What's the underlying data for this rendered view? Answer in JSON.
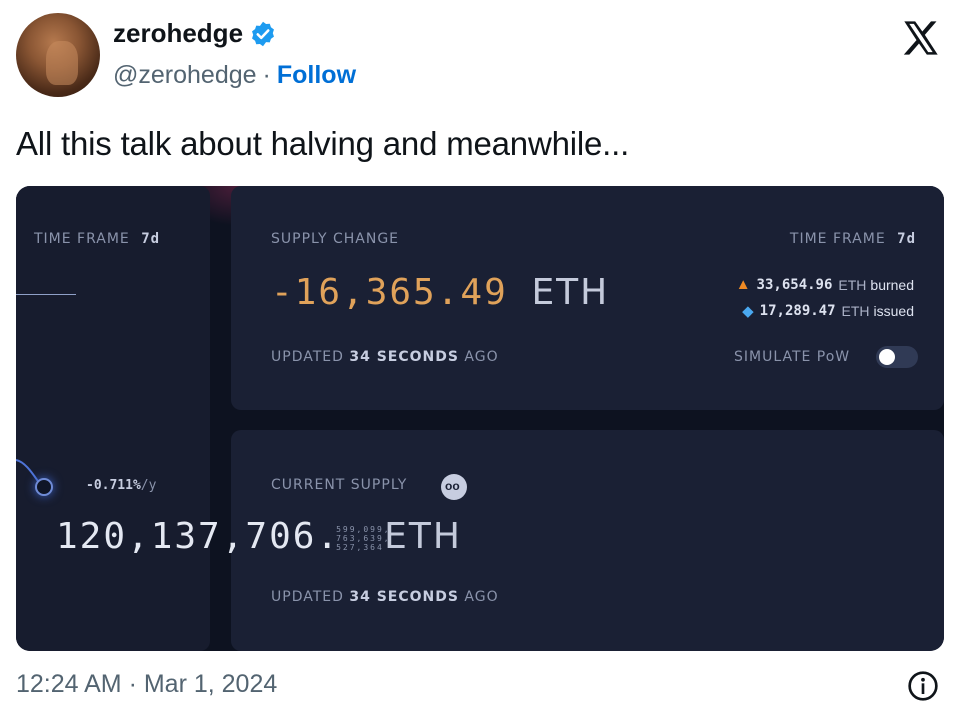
{
  "header": {
    "display_name": "zerohedge",
    "handle": "@zerohedge",
    "separator": "·",
    "follow_label": "Follow"
  },
  "tweet": {
    "text": "All this talk about halving and meanwhile...",
    "timestamp": "12:24 AM · Mar 1, 2024"
  },
  "dashboard": {
    "left": {
      "time_frame_label": "TIME FRAME",
      "time_frame_value": "7d",
      "rate_value": "-0.711%",
      "rate_unit": "/y"
    },
    "supply_change": {
      "label": "SUPPLY CHANGE",
      "value": "-16,365.49",
      "unit": "ETH",
      "updated_prefix": "UPDATED",
      "updated_value": "34 SECONDS",
      "updated_suffix": "AGO",
      "time_frame_label": "TIME FRAME",
      "time_frame_value": "7d",
      "burned_value": "33,654.96",
      "burned_unit": "ETH",
      "burned_label": "burned",
      "issued_value": "17,289.47",
      "issued_unit": "ETH",
      "issued_label": "issued",
      "simulate_label": "SIMULATE PoW"
    },
    "current_supply": {
      "label": "CURRENT SUPPLY",
      "value": "120,137,706.",
      "decimals_line1": "599,099,",
      "decimals_line2": "763,639,",
      "decimals_line3": "527,364",
      "unit": "ETH",
      "updated_prefix": "UPDATED",
      "updated_value": "34 SECONDS",
      "updated_suffix": "AGO"
    }
  },
  "colors": {
    "accent_follow": "#006fd6",
    "verified": "#1d9bf0",
    "supply_change": "#e0a25a",
    "panel_bg": "#1a2034"
  },
  "icons": {
    "verified": "verified-badge-icon",
    "platform": "x-logo-icon",
    "burn": "fire-icon",
    "issue": "water-drop-icon",
    "supply": "nerd-face-icon",
    "info": "info-icon"
  }
}
